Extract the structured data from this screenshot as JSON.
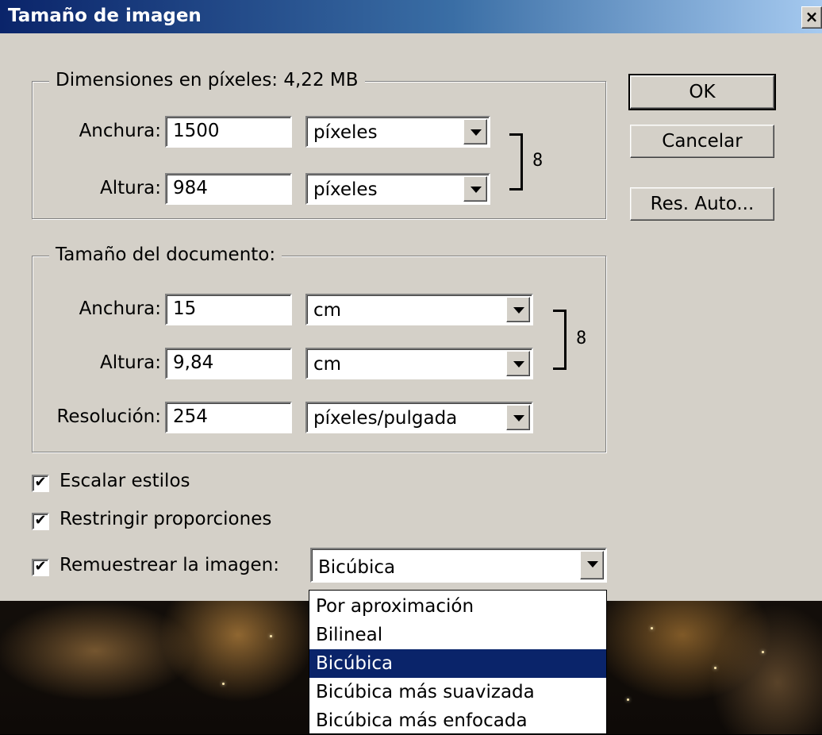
{
  "window": {
    "title": "Tamaño de imagen",
    "close_glyph": "×"
  },
  "pixel_dimensions": {
    "group_label": "Dimensiones en píxeles: 4,22 MB",
    "width_label": "Anchura:",
    "width_value": "1500",
    "width_unit": "píxeles",
    "height_label": "Altura:",
    "height_value": "984",
    "height_unit": "píxeles"
  },
  "document_size": {
    "group_label": "Tamaño del documento:",
    "width_label": "Anchura:",
    "width_value": "15",
    "width_unit": "cm",
    "height_label": "Altura:",
    "height_value": "9,84",
    "height_unit": "cm",
    "resolution_label": "Resolución:",
    "resolution_value": "254",
    "resolution_unit": "píxeles/pulgada"
  },
  "buttons": {
    "ok": "OK",
    "cancel": "Cancelar",
    "auto": "Res. Auto..."
  },
  "options": {
    "scale_styles": {
      "label": "Escalar estilos",
      "checked": true
    },
    "constrain": {
      "label": "Restringir proporciones",
      "checked": true
    },
    "resample": {
      "label": "Remuestrear la imagen:",
      "checked": true,
      "value": "Bicúbica"
    }
  },
  "resample_menu": {
    "items": [
      "Por aproximación",
      "Bilineal",
      "Bicúbica",
      "Bicúbica más suavizada",
      "Bicúbica más enfocada"
    ],
    "selected_index": 2
  },
  "check_glyph": "✔",
  "chain_glyph": "8",
  "colors": {
    "title_start": "#0a246a",
    "title_end": "#a6caf0",
    "dialog_bg": "#d4d0c8",
    "highlight": "#0a246a"
  }
}
